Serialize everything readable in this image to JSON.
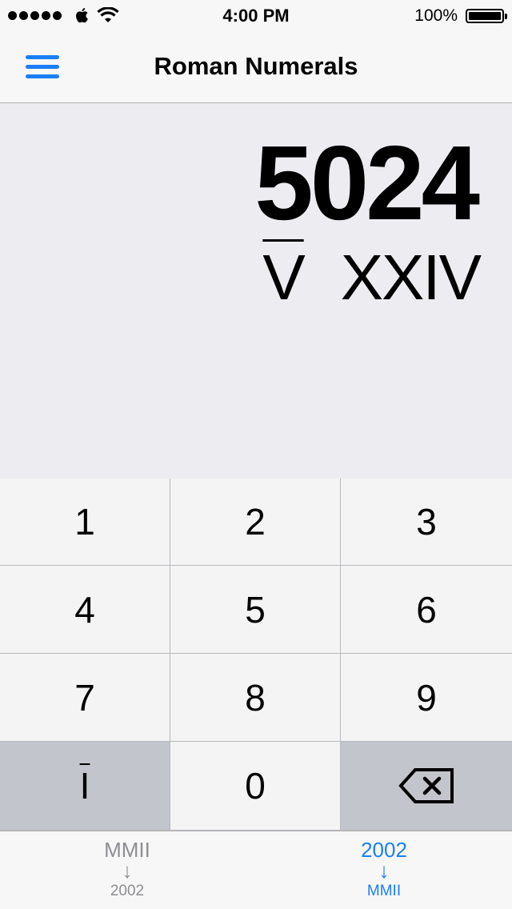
{
  "status_bar": {
    "time": "4:00 PM",
    "battery": "100%",
    "icons": [
      "signal-dots-icon",
      "apple-icon",
      "wifi-icon",
      "battery-icon"
    ]
  },
  "nav": {
    "title": "Roman Numerals",
    "menu_icon": "hamburger-menu-icon"
  },
  "display": {
    "arabic": "5024",
    "roman_thousands": "V",
    "roman_rest": "XXIV"
  },
  "keypad": {
    "keys": [
      "1",
      "2",
      "3",
      "4",
      "5",
      "6",
      "7",
      "8",
      "9",
      "I",
      "0"
    ],
    "overline_key_label": "I",
    "backspace_icon": "backspace-icon"
  },
  "tabs": [
    {
      "top": "MMII",
      "arrow": "↓",
      "bottom": "2002",
      "selected": false
    },
    {
      "top": "2002",
      "arrow": "↓",
      "bottom": "MMII",
      "selected": true
    }
  ],
  "colors": {
    "accent": "#1a7ff5",
    "display_bg": "#ececf1",
    "key_bg": "#f4f4f4",
    "dark_key_bg": "#c3c5cc",
    "tab_inactive": "#8e8e93"
  }
}
